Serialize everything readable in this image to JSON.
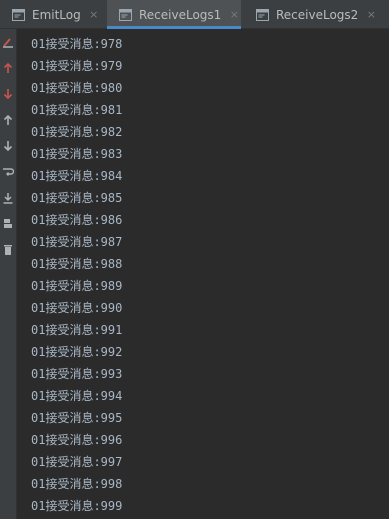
{
  "tabs": [
    {
      "label": "EmitLog",
      "active": false
    },
    {
      "label": "ReceiveLogs1",
      "active": true
    },
    {
      "label": "ReceiveLogs2",
      "active": false
    }
  ],
  "close_glyph": "×",
  "toolbar": [
    {
      "name": "rerun-icon",
      "color": "#c75450"
    },
    {
      "name": "scroll-up-red-icon",
      "color": "#c75450"
    },
    {
      "name": "scroll-down-red-icon",
      "color": "#c75450"
    },
    {
      "name": "up-arrow-icon",
      "color": "#afb1b3"
    },
    {
      "name": "down-arrow-icon",
      "color": "#afb1b3"
    },
    {
      "name": "soft-wrap-icon",
      "color": "#afb1b3"
    },
    {
      "name": "scroll-to-end-icon",
      "color": "#afb1b3"
    },
    {
      "name": "print-icon",
      "color": "#afb1b3"
    },
    {
      "name": "clear-icon",
      "color": "#afb1b3"
    }
  ],
  "console": {
    "lines": [
      "01接受消息:978",
      "01接受消息:979",
      "01接受消息:980",
      "01接受消息:981",
      "01接受消息:982",
      "01接受消息:983",
      "01接受消息:984",
      "01接受消息:985",
      "01接受消息:986",
      "01接受消息:987",
      "01接受消息:988",
      "01接受消息:989",
      "01接受消息:990",
      "01接受消息:991",
      "01接受消息:992",
      "01接受消息:993",
      "01接受消息:994",
      "01接受消息:995",
      "01接受消息:996",
      "01接受消息:997",
      "01接受消息:998",
      "01接受消息:999"
    ]
  },
  "colors": {
    "background": "#2b2b2b",
    "text": "#a9b7c6",
    "tab_active_underline": "#4a88c7"
  }
}
